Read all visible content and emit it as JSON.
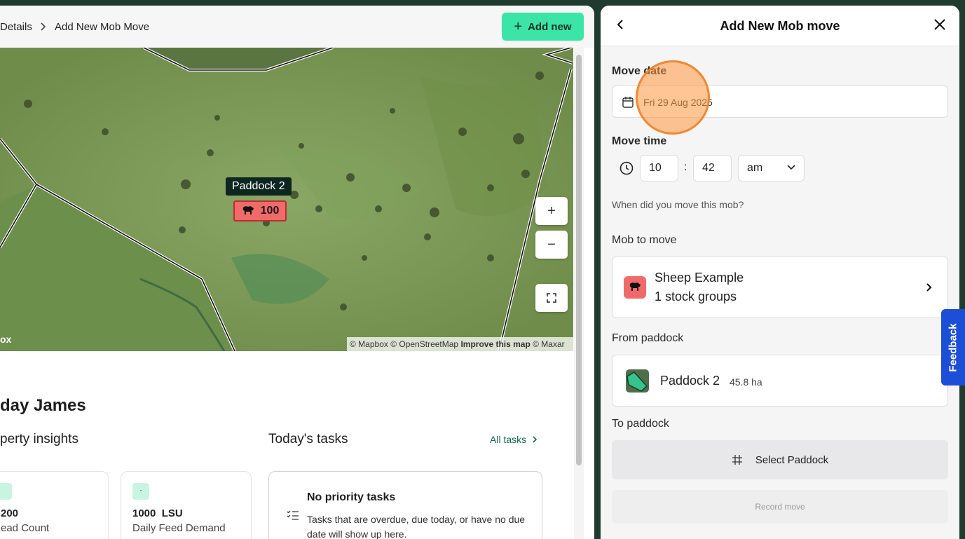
{
  "breadcrumb": {
    "prev": "Details",
    "current": "Add New Mob Move"
  },
  "toolbar": {
    "add_new_label": "Add new"
  },
  "map": {
    "paddock_label": "Paddock 2",
    "mob_count": "100",
    "attribution_prefix": "© Mapbox © OpenStreetMap ",
    "attribution_link": "Improve this map",
    "attribution_suffix": " © Maxar",
    "logo_text": "ox",
    "zoom_in": "+",
    "zoom_out": "−"
  },
  "dashboard": {
    "greeting": "day James",
    "insights_title": "perty insights",
    "tasks_title": "Today's tasks",
    "all_tasks_label": "All tasks",
    "insights": [
      {
        "badge": "",
        "value": "200",
        "label": "ead Count"
      },
      {
        "badge": "·",
        "value": "1000  LSU",
        "label": "Daily Feed Demand"
      }
    ],
    "tasks_card": {
      "heading": "No priority tasks",
      "description": "Tasks that are overdue, due today, or have no due date will show up here."
    }
  },
  "panel": {
    "title": "Add New Mob move",
    "move_date_label": "Move date",
    "move_date_value": "Fri 29 Aug 2025",
    "move_time_label": "Move time",
    "hour": "10",
    "minute": "42",
    "ampm": "am",
    "time_help": "When did you move this mob?",
    "mob_label": "Mob to move",
    "mob_name": "Sheep Example",
    "mob_groups": "1 stock groups",
    "from_label": "From paddock",
    "from_paddock": "Paddock 2",
    "from_area": "45.8 ha",
    "to_label": "To paddock",
    "select_paddock": "Select Paddock",
    "record_move": "Record move"
  },
  "feedback_label": "Feedback",
  "colors": {
    "accent_green": "#3be5a8",
    "mob_red": "#f06a6a",
    "feedback_blue": "#1d4ed8",
    "link_green": "#0f6b4a"
  }
}
